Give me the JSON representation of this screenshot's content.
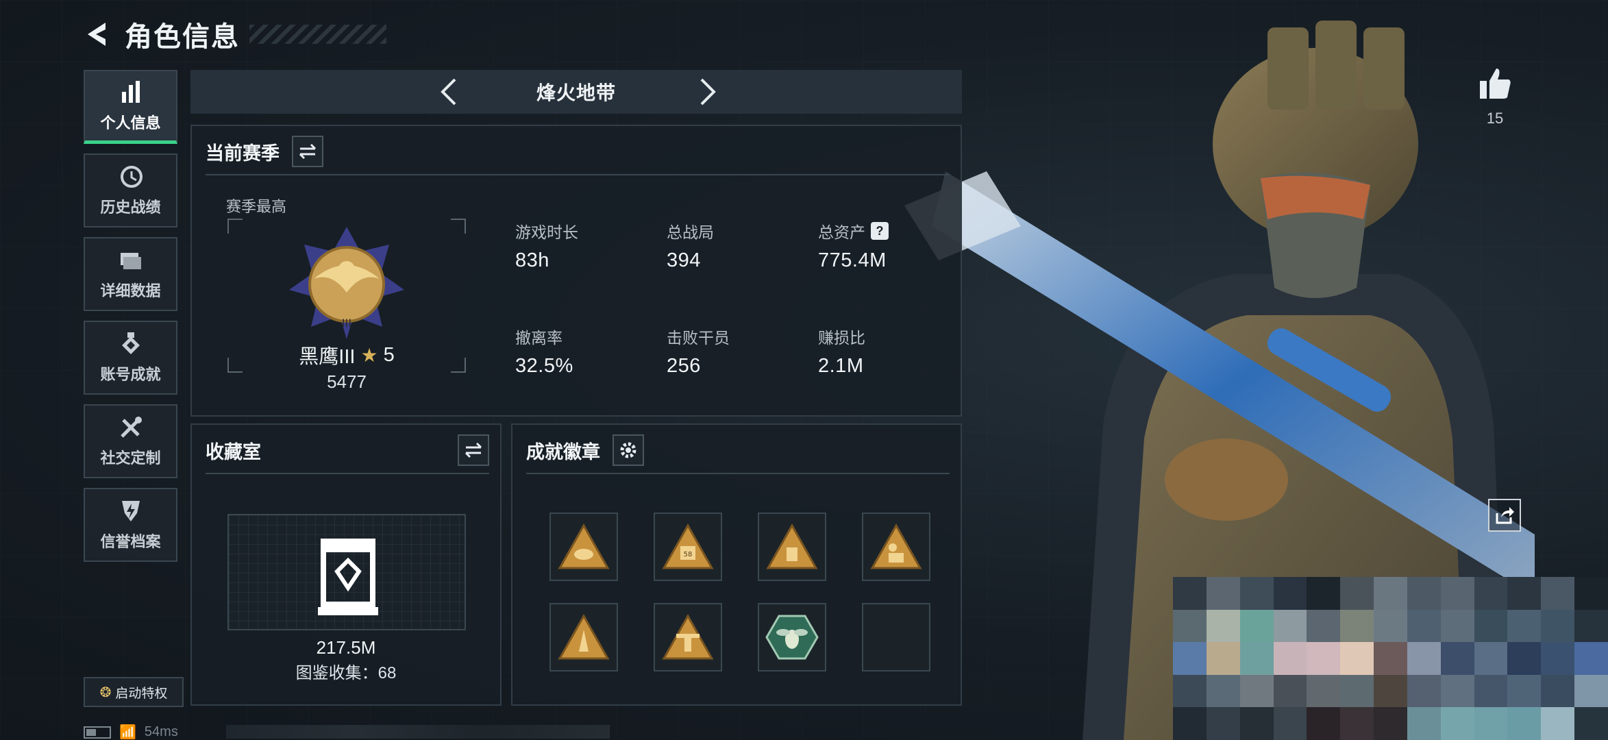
{
  "header": {
    "title": "角色信息"
  },
  "sidebar": {
    "items": [
      {
        "label": "个人信息",
        "icon": "bar-chart-icon",
        "active": true
      },
      {
        "label": "历史战绩",
        "icon": "history-clock-icon"
      },
      {
        "label": "详细数据",
        "icon": "folder-stack-icon"
      },
      {
        "label": "账号成就",
        "icon": "medal-icon"
      },
      {
        "label": "社交定制",
        "icon": "tools-icon"
      },
      {
        "label": "信誉档案",
        "icon": "shield-bolt-icon"
      }
    ],
    "perk_button": "启动特权"
  },
  "status": {
    "ping": "54ms"
  },
  "mode": {
    "title": "烽火地带"
  },
  "season": {
    "title": "当前赛季",
    "best_label": "赛季最高",
    "rank_name": "黑鹰III",
    "rank_stars": "5",
    "rank_score": "5477",
    "stats": [
      {
        "label": "游戏时长",
        "value": "83h"
      },
      {
        "label": "总战局",
        "value": "394"
      },
      {
        "label": "总资产",
        "value": "775.4M",
        "help": "?"
      },
      {
        "label": "撤离率",
        "value": "32.5%"
      },
      {
        "label": "击败干员",
        "value": "256"
      },
      {
        "label": "赚损比",
        "value": "2.1M"
      }
    ]
  },
  "collection": {
    "title": "收藏室",
    "value": "217.5M",
    "count_text": "图鉴收集：68"
  },
  "achievements": {
    "title": "成就徽章",
    "badges": [
      {
        "icon": "gold-triangle-badge-icon"
      },
      {
        "icon": "gold-triangle-58-badge-icon"
      },
      {
        "icon": "gold-triangle-crate-badge-icon"
      },
      {
        "icon": "gold-triangle-operator-badge-icon"
      },
      {
        "icon": "gold-triangle-rocket-badge-icon"
      },
      {
        "icon": "gold-triangle-tower-badge-icon"
      },
      {
        "icon": "green-hexagon-wasp-badge-icon"
      },
      {
        "icon": "empty-badge-slot"
      }
    ]
  },
  "social": {
    "likes": "15"
  },
  "colors": {
    "accent_green": "#3ad28a",
    "badge_gold": "#d7a64a",
    "panel_bg": "#181f26"
  }
}
